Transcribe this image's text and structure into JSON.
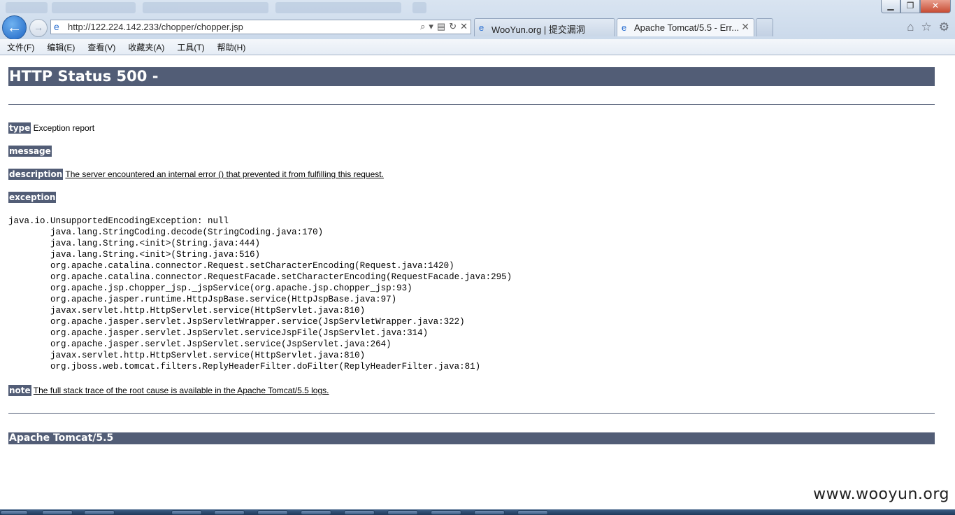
{
  "window": {
    "minimize": "▁",
    "maximize": "❐",
    "close": "✕"
  },
  "nav": {
    "back": "←",
    "forward": "→"
  },
  "address": {
    "url": "http://122.224.142.233/chopper/chopper.jsp",
    "page_icon": "e",
    "search_icon": "⌕",
    "dropdown_icon": "▾",
    "compat_icon": "▤",
    "refresh_icon": "↻",
    "stop_icon": "✕"
  },
  "tabs": [
    {
      "label": "WooYun.org | 提交漏洞",
      "icon": "e"
    },
    {
      "label": "Apache Tomcat/5.5 - Err...",
      "icon": "e",
      "close": "✕"
    }
  ],
  "toolbar_icons": {
    "home": "⌂",
    "favorites": "☆",
    "tools": "⚙"
  },
  "menu": [
    "文件(F)",
    "编辑(E)",
    "查看(V)",
    "收藏夹(A)",
    "工具(T)",
    "帮助(H)"
  ],
  "page": {
    "title": "HTTP Status 500 -",
    "type_label": "type",
    "type_value": "Exception report",
    "message_label": "message",
    "description_label": "description",
    "description_value": "The server encountered an internal error () that prevented it from fulfilling this request.",
    "exception_label": "exception",
    "stack_trace": [
      "java.io.UnsupportedEncodingException: null",
      "\tjava.lang.StringCoding.decode(StringCoding.java:170)",
      "\tjava.lang.String.<init>(String.java:444)",
      "\tjava.lang.String.<init>(String.java:516)",
      "\torg.apache.catalina.connector.Request.setCharacterEncoding(Request.java:1420)",
      "\torg.apache.catalina.connector.RequestFacade.setCharacterEncoding(RequestFacade.java:295)",
      "\torg.apache.jsp.chopper_jsp._jspService(org.apache.jsp.chopper_jsp:93)",
      "\torg.apache.jasper.runtime.HttpJspBase.service(HttpJspBase.java:97)",
      "\tjavax.servlet.http.HttpServlet.service(HttpServlet.java:810)",
      "\torg.apache.jasper.servlet.JspServletWrapper.service(JspServletWrapper.java:322)",
      "\torg.apache.jasper.servlet.JspServlet.serviceJspFile(JspServlet.java:314)",
      "\torg.apache.jasper.servlet.JspServlet.service(JspServlet.java:264)",
      "\tjavax.servlet.http.HttpServlet.service(HttpServlet.java:810)",
      "\torg.jboss.web.tomcat.filters.ReplyHeaderFilter.doFilter(ReplyHeaderFilter.java:81)"
    ],
    "note_label": "note",
    "note_value": "The full stack trace of the root cause is available in the Apache Tomcat/5.5 logs.",
    "footer": "Apache Tomcat/5.5"
  },
  "watermark": "www.wooyun.org"
}
